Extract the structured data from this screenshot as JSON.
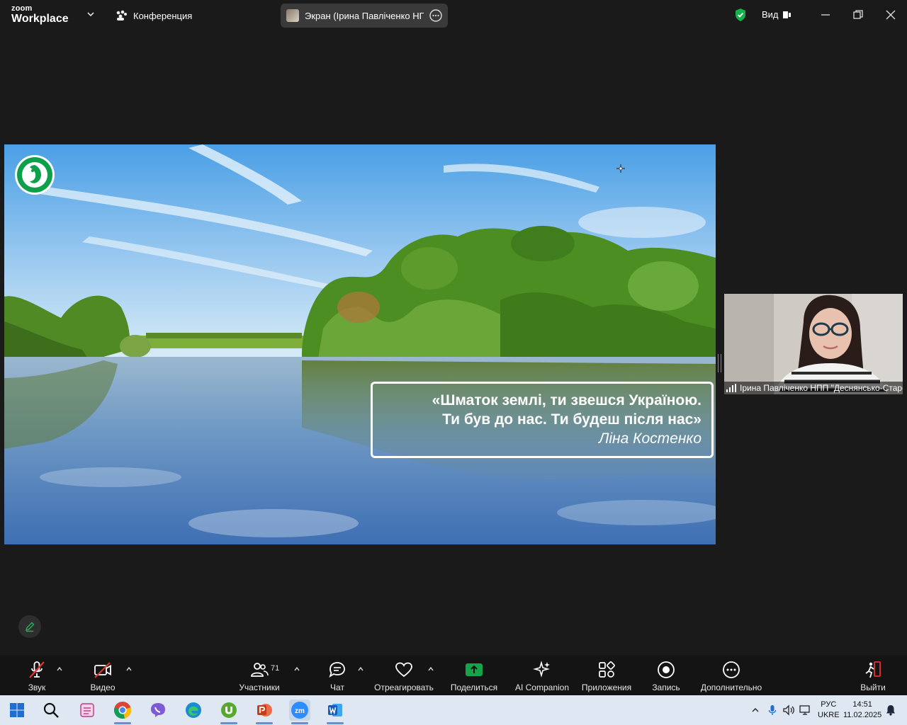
{
  "app": {
    "brand_small": "zoom",
    "brand_big": "Workplace",
    "meeting_label": "Конференция",
    "screen_tab_label": "Экран (Ірина Павліченко НПП \"Деснянсько-Старогутський\")",
    "view_label": "Вид"
  },
  "presentation": {
    "quote_line1": "«Шматок землі, ти звешся Україною.",
    "quote_line2": "Ти був до нас. Ти будеш після нас»",
    "author": "Ліна Костенко"
  },
  "participant": {
    "name": "Ірина Павліченко НПП \"Деснянсько-Старогутський\""
  },
  "toolbar": {
    "audio": "Звук",
    "video": "Видео",
    "participants": "Участники",
    "participants_count": "71",
    "chat": "Чат",
    "react": "Отреагировать",
    "share": "Поделиться",
    "ai": "AI Companion",
    "apps": "Приложения",
    "record": "Запись",
    "more": "Дополнительно",
    "leave": "Выйти"
  },
  "taskbar": {
    "lang_top": "РУС",
    "lang_bottom": "UKRE",
    "time": "14:51",
    "date": "11.02.2025"
  },
  "colors": {
    "accent_green": "#0e9f4b",
    "leave_red": "#e5322d",
    "share_green": "#17a34a"
  }
}
